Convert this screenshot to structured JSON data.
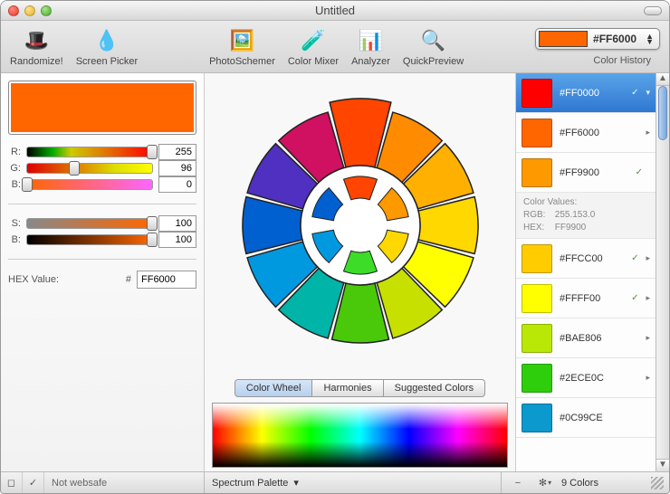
{
  "window": {
    "title": "Untitled"
  },
  "toolbar": {
    "items": [
      {
        "label": "Randomize!",
        "icon": "🎩"
      },
      {
        "label": "Screen Picker",
        "icon": "💧"
      },
      {
        "label": "PhotoSchemer",
        "icon": "🖼️"
      },
      {
        "label": "Color Mixer",
        "icon": "🧪"
      },
      {
        "label": "Analyzer",
        "icon": "📊"
      },
      {
        "label": "QuickPreview",
        "icon": "🔍"
      }
    ]
  },
  "current": {
    "hex": "#FF6000",
    "history_label": "Color History",
    "color": "#ff6600"
  },
  "sliders": {
    "r": {
      "label": "R:",
      "value": "255",
      "gradient": "linear-gradient(90deg,#000,#0a0 20%,#cc0 35%,#f00)",
      "pos": 100
    },
    "g": {
      "label": "G:",
      "value": "96",
      "gradient": "linear-gradient(90deg,#d00,#dd0 70%,#ff0)",
      "pos": 38
    },
    "b": {
      "label": "B:",
      "value": "0",
      "gradient": "linear-gradient(90deg,#f60,#f6f)",
      "pos": 0
    },
    "s": {
      "label": "S:",
      "value": "100",
      "gradient": "linear-gradient(90deg,#888,#f60)",
      "pos": 100
    },
    "br": {
      "label": "B:",
      "value": "100",
      "gradient": "linear-gradient(90deg,#000,#f60)",
      "pos": 100
    }
  },
  "hex": {
    "label": "HEX Value:",
    "hash": "#",
    "value": "FF6000"
  },
  "tabs": {
    "a": "Color Wheel",
    "b": "Harmonies",
    "c": "Suggested Colors"
  },
  "wheel_colors": [
    "#ff4500",
    "#ff8c00",
    "#ffb000",
    "#ffd800",
    "#ffff00",
    "#c8e000",
    "#4ac80a",
    "#00b4a8",
    "#0099e0",
    "#0060d0",
    "#5030c0",
    "#d01060"
  ],
  "hub_colors": [
    "#ff4500",
    "#ff9900",
    "#ffd800",
    "#3cdc28",
    "#0099e0",
    "#0060d0"
  ],
  "history": {
    "items": [
      {
        "hex": "#FF0000",
        "color": "#ff0000",
        "checked": true,
        "selected": true
      },
      {
        "hex": "#FF6000",
        "color": "#ff6600",
        "disclose": true
      },
      {
        "hex": "#FF9900",
        "color": "#ff9900",
        "checked": true,
        "expanded": true,
        "rgb": "255.153.0",
        "hexd": "FF9900"
      },
      {
        "hex": "#FFCC00",
        "color": "#ffcc00",
        "checked": true,
        "disclose": true
      },
      {
        "hex": "#FFFF00",
        "color": "#ffff00",
        "checked": true,
        "disclose": true
      },
      {
        "hex": "#BAE806",
        "color": "#bae806",
        "disclose": true
      },
      {
        "hex": "#2ECE0C",
        "color": "#2ece0c",
        "disclose": true
      },
      {
        "hex": "#0C99CE",
        "color": "#0c99ce"
      }
    ],
    "detail_label": "Color Values:",
    "rgb_label": "RGB:",
    "hex_label": "HEX:"
  },
  "status": {
    "left_text": "Not websafe",
    "center_text": "Spectrum Palette",
    "right_text": "9 Colors",
    "minus": "−",
    "gear": "✻",
    "check": "✓",
    "square": "◻",
    "tri": "▾"
  }
}
